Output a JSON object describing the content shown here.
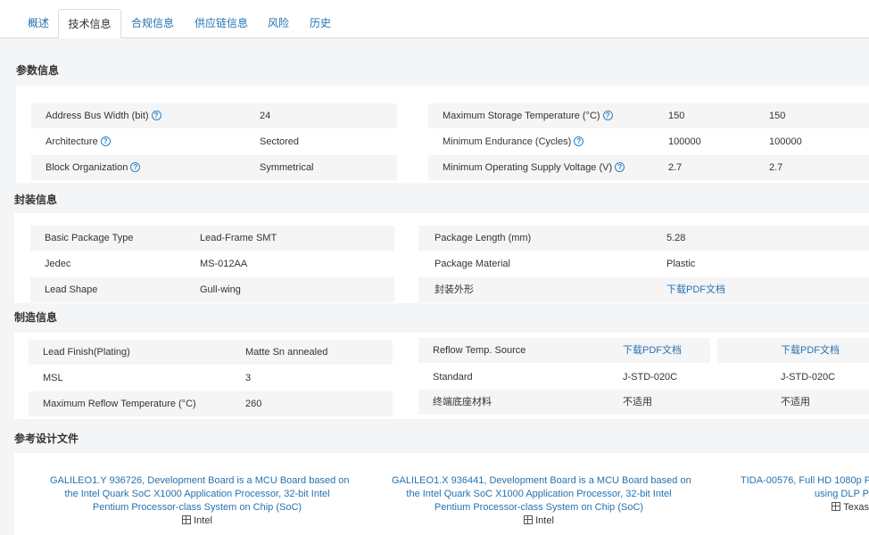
{
  "tabs": [
    {
      "label": "概述"
    },
    {
      "label": "技术信息"
    },
    {
      "label": "合规信息"
    },
    {
      "label": "供应链信息"
    },
    {
      "label": "风险"
    },
    {
      "label": "历史"
    }
  ],
  "active_tab": "技术信息",
  "params": {
    "title": "参数信息",
    "left": [
      {
        "label": "Address Bus Width (bit)",
        "value": "24"
      },
      {
        "label": "Architecture",
        "value": "Sectored"
      },
      {
        "label": "Block Organization",
        "value": "Symmetrical"
      }
    ],
    "right": [
      {
        "label": "Maximum Storage Temperature (°C)",
        "value1": "150",
        "value2": "150"
      },
      {
        "label": "Minimum Endurance (Cycles)",
        "value1": "100000",
        "value2": "100000"
      },
      {
        "label": "Minimum Operating Supply Voltage (V)",
        "value1": "2.7",
        "value2": "2.7"
      }
    ]
  },
  "package": {
    "title": "封装信息",
    "left": [
      {
        "label": "Basic Package Type",
        "value": "Lead-Frame SMT"
      },
      {
        "label": "Jedec",
        "value": "MS-012AA"
      },
      {
        "label": "Lead Shape",
        "value": "Gull-wing"
      }
    ],
    "right": [
      {
        "label": "Package Length (mm)",
        "value": "5.28"
      },
      {
        "label": "Package Material",
        "value": "Plastic"
      },
      {
        "label": "封装外形",
        "value": "下载PDF文档"
      }
    ]
  },
  "manufacturing": {
    "title": "制造信息",
    "left": [
      {
        "label": "Lead Finish(Plating)",
        "value": "Matte Sn annealed"
      },
      {
        "label": "MSL",
        "value": "3"
      },
      {
        "label": "Maximum Reflow Temperature (°C)",
        "value": "260"
      }
    ],
    "right": [
      {
        "label": "Reflow Temp. Source",
        "value1": "下载PDF文档",
        "value2": "下载PDF文档"
      },
      {
        "label": "Standard",
        "value1": "J-STD-020C",
        "value2": "J-STD-020C"
      },
      {
        "label": "终端底座材料",
        "value1": "不适用",
        "value2": "不适用"
      }
    ]
  },
  "reference": {
    "title": "参考设计文件",
    "items": [
      {
        "lines": [
          "GALILEO1.Y 936726, Development Board is a MCU Board based on",
          "the Intel Quark SoC X1000 Application Processor, 32-bit Intel",
          "Pentium Processor-class System on Chip (SoC)"
        ],
        "manufacturer": "Intel"
      },
      {
        "lines": [
          "GALILEO1.X 936441, Development Board is a MCU Board based on",
          "the Intel Quark SoC X1000 Application Processor, 32-bit Intel",
          "Pentium Processor-class System on Chip (SoC)"
        ],
        "manufacturer": "Intel"
      },
      {
        "lines": [
          "TIDA-00576, Full HD 1080p Pr",
          "using DLP P"
        ],
        "manufacturer": "Texas"
      }
    ]
  }
}
